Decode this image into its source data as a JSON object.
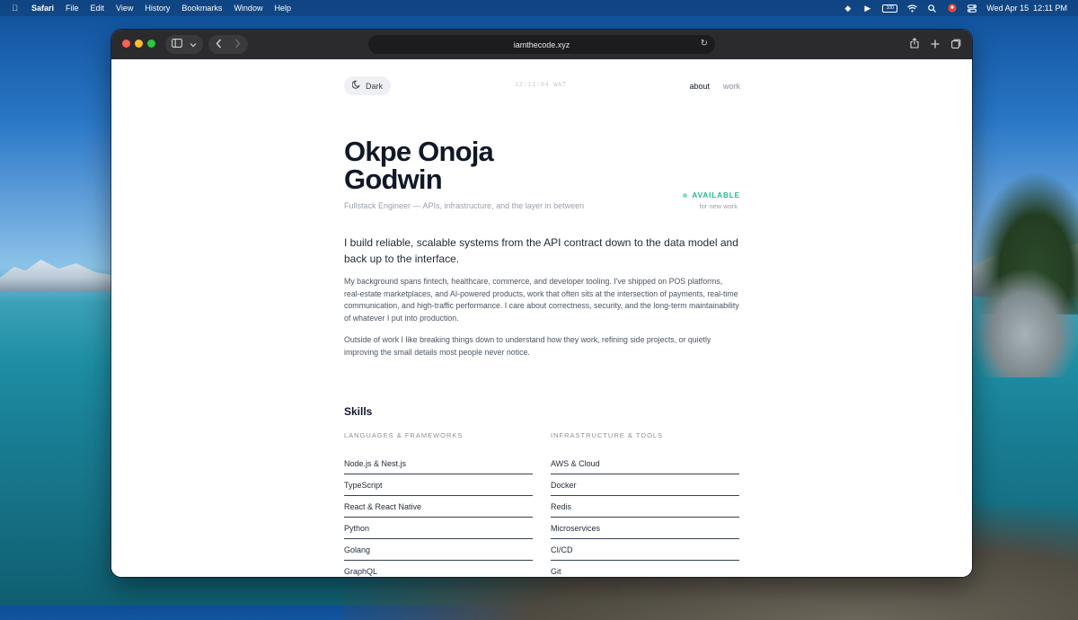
{
  "menubar": {
    "app": "Safari",
    "menus": [
      "File",
      "Edit",
      "View",
      "History",
      "Bookmarks",
      "Window",
      "Help"
    ],
    "datetime": "Wed Apr 15  12:11 PM",
    "battery": "100"
  },
  "browser": {
    "url": "iamthecode.xyz"
  },
  "page": {
    "theme_toggle": "Dark",
    "clock": "12:11:04 WAT",
    "nav": {
      "about": "about",
      "work": "work"
    },
    "name_line1": "Okpe Onoja",
    "name_line2": "Godwin",
    "subtitle": "Fullstack Engineer — APIs, infrastructure, and the layer in between",
    "availability": {
      "status": "AVAILABLE",
      "note": "for new work",
      "color": "#1fb98a"
    },
    "lead": "I build reliable, scalable systems from the API contract down to the data model and back up to the interface.",
    "paragraph1": "My background spans fintech, healthcare, commerce, and developer tooling. I've shipped on POS platforms, real-estate marketplaces, and AI-powered products, work that often sits at the intersection of payments, real-time communication, and high-traffic performance. I care about correctness, security, and the long-term maintainability of whatever I put into production.",
    "paragraph2": "Outside of work I like breaking things down to understand how they work, refining side projects, or quietly improving the small details most people never notice.",
    "skills": {
      "title": "Skills",
      "languages_heading": "LANGUAGES & FRAMEWORKS",
      "languages": [
        "Node.js & Nest.js",
        "TypeScript",
        "React & React Native",
        "Python",
        "Golang",
        "GraphQL"
      ],
      "infra_heading": "INFRASTRUCTURE & TOOLS",
      "infra": [
        "AWS & Cloud",
        "Docker",
        "Redis",
        "Microservices",
        "CI/CD",
        "Git"
      ]
    }
  }
}
